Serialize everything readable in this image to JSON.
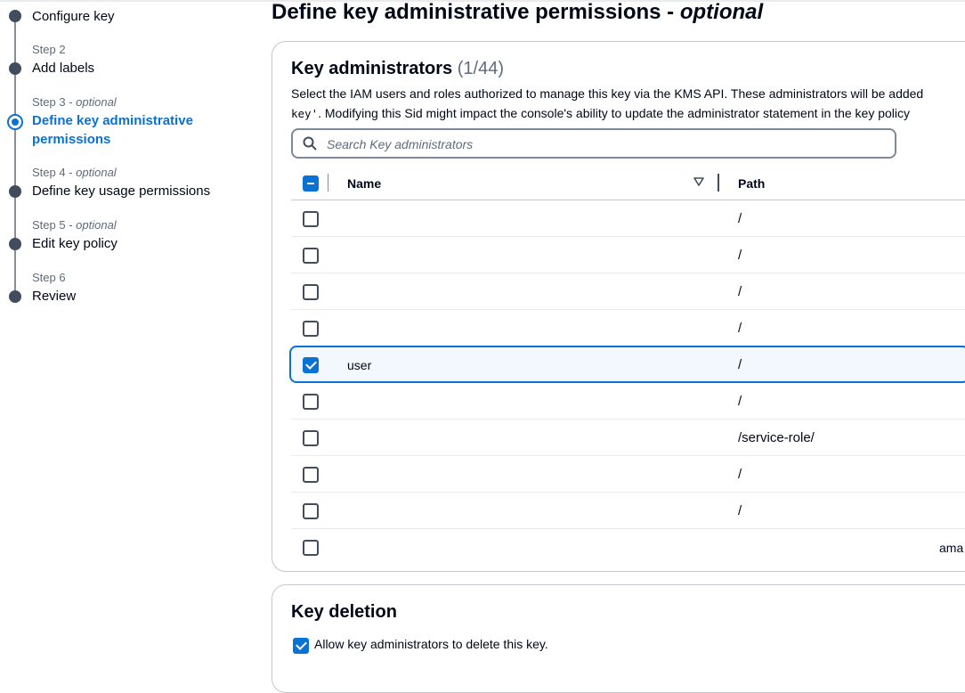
{
  "wizard": {
    "steps": [
      {
        "label": "",
        "optional": "",
        "title": "Configure key",
        "state": "done"
      },
      {
        "label": "Step 2",
        "optional": "",
        "title": "Add labels",
        "state": "done"
      },
      {
        "label": "Step 3",
        "optional": "optional",
        "title": "Define key administrative permissions",
        "state": "active"
      },
      {
        "label": "Step 4",
        "optional": "optional",
        "title": "Define key usage permissions",
        "state": "pending"
      },
      {
        "label": "Step 5",
        "optional": "optional",
        "title": "Edit key policy",
        "state": "pending"
      },
      {
        "label": "Step 6",
        "optional": "",
        "title": "Review",
        "state": "pending"
      }
    ]
  },
  "page": {
    "title_main": "Define key administrative permissions - ",
    "title_optional": "optional"
  },
  "key_admins": {
    "title": "Key administrators",
    "count": "(1/44)",
    "desc_line1": "Select the IAM users and roles authorized to manage this key via the KMS API. These administrators will be added",
    "desc_code": "key'",
    "desc_line2": ". Modifying this Sid might impact the console's ability to update the administrator statement in the key policy",
    "search_placeholder": "Search Key administrators",
    "columns": {
      "name": "Name",
      "path": "Path"
    },
    "rows": [
      {
        "name": "",
        "path": "/",
        "checked": false
      },
      {
        "name": "",
        "path": "/",
        "checked": false
      },
      {
        "name": "",
        "path": "/",
        "checked": false
      },
      {
        "name": "",
        "path": "/",
        "checked": false
      },
      {
        "name": "user",
        "path": "/",
        "checked": true
      },
      {
        "name": "",
        "path": "/",
        "checked": false
      },
      {
        "name": "",
        "path": "/service-role/",
        "checked": false
      },
      {
        "name": "",
        "path": "/",
        "checked": false
      },
      {
        "name": "",
        "path": "/",
        "checked": false
      },
      {
        "name": "",
        "path": "",
        "extra": "ama",
        "checked": false
      }
    ]
  },
  "key_deletion": {
    "title": "Key deletion",
    "allow_label": "Allow key administrators to delete this key.",
    "allow_checked": true
  },
  "colors": {
    "accent": "#0972d3",
    "text": "#000716",
    "muted": "#5f6b7a",
    "border": "#c6c6cd"
  }
}
